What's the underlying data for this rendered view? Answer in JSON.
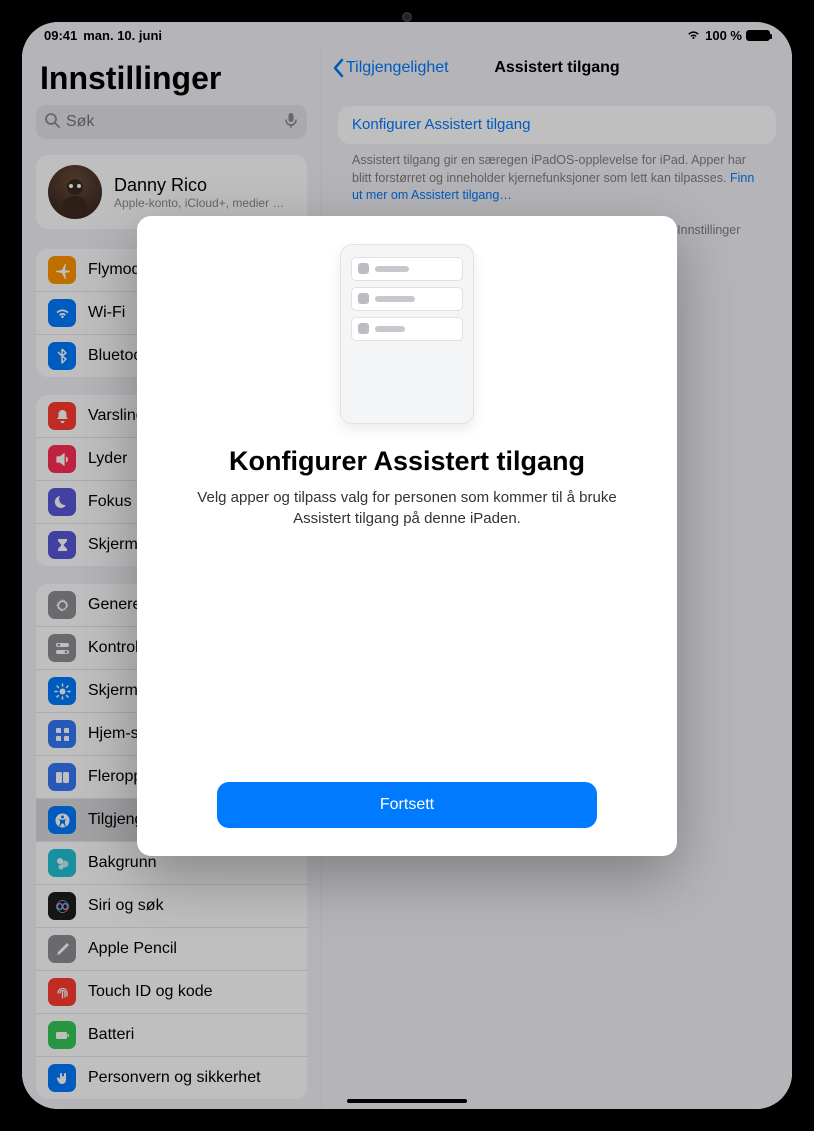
{
  "status": {
    "time": "09:41",
    "date": "man. 10. juni",
    "battery_pct": "100 %"
  },
  "sidebar": {
    "title": "Innstillinger",
    "search_placeholder": "Søk",
    "profile": {
      "name": "Danny Rico",
      "sub": "Apple-konto, iCloud+, medier …"
    },
    "group1": [
      {
        "label": "Flymodus",
        "icon": "airplane-icon",
        "color": "#ff9500"
      },
      {
        "label": "Wi-Fi",
        "icon": "wifi-icon",
        "color": "#007aff"
      },
      {
        "label": "Bluetooth",
        "icon": "bluetooth-icon",
        "color": "#007aff"
      }
    ],
    "group2": [
      {
        "label": "Varslinger",
        "icon": "bell-icon",
        "color": "#ff3b30"
      },
      {
        "label": "Lyder",
        "icon": "speaker-icon",
        "color": "#ff2d55"
      },
      {
        "label": "Fokus",
        "icon": "moon-icon",
        "color": "#5856d6"
      },
      {
        "label": "Skjermtid",
        "icon": "hourglass-icon",
        "color": "#5856d6"
      }
    ],
    "group3": [
      {
        "label": "Generelt",
        "icon": "gear-icon",
        "color": "#8e8e93"
      },
      {
        "label": "Kontrollsenter",
        "icon": "toggles-icon",
        "color": "#8e8e93"
      },
      {
        "label": "Skjerm og lysstyrke",
        "icon": "brightness-icon",
        "color": "#007aff"
      },
      {
        "label": "Hjem-skjerm og appbibliotek",
        "icon": "grid-icon",
        "color": "#3478f6"
      },
      {
        "label": "Fleroppgavekjøring og bevegelser",
        "icon": "multitask-icon",
        "color": "#3478f6"
      },
      {
        "label": "Tilgjengelighet",
        "icon": "accessibility-icon",
        "color": "#007aff",
        "selected": true
      },
      {
        "label": "Bakgrunn",
        "icon": "wallpaper-icon",
        "color": "#22c1d6"
      },
      {
        "label": "Siri og søk",
        "icon": "siri-icon",
        "color": "#1c1c1e"
      },
      {
        "label": "Apple Pencil",
        "icon": "pencil-icon",
        "color": "#8e8e93"
      },
      {
        "label": "Touch ID og kode",
        "icon": "touchid-icon",
        "color": "#ff3b30"
      },
      {
        "label": "Batteri",
        "icon": "battery-icon",
        "color": "#34c759"
      },
      {
        "label": "Personvern og sikkerhet",
        "icon": "hand-icon",
        "color": "#007aff"
      }
    ]
  },
  "detail": {
    "back": "Tilgjengelighet",
    "title": "Assistert tilgang",
    "card_link": "Konfigurer Assistert tilgang",
    "desc1": "Assistert tilgang gir en særegen iPadOS-opplevelse for iPad. Apper har blitt forstørret og inneholder kjernefunksjoner som lett kan tilpasses. ",
    "desc_link": "Finn ut mer om Assistert tilgang…",
    "desc2": "Du kan når som helst gjøre endringer i Assistert tilgang fra Innstillinger"
  },
  "modal": {
    "title": "Konfigurer Assistert tilgang",
    "subtitle": "Velg apper og tilpass valg for personen som kommer til å bruke Assistert tilgang på denne iPaden.",
    "cta": "Fortsett"
  }
}
